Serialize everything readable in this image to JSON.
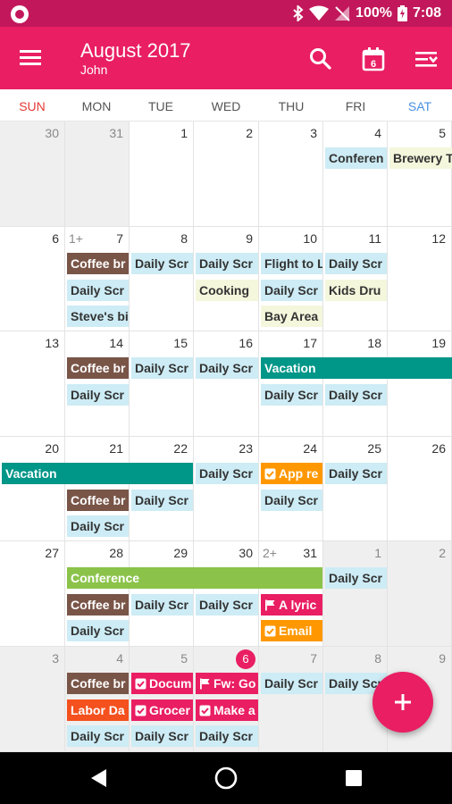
{
  "status": {
    "battery": "100%",
    "time": "7:08"
  },
  "appbar": {
    "title": "August 2017",
    "subtitle": "John",
    "today_badge": "6"
  },
  "weekdays": [
    "SUN",
    "MON",
    "TUE",
    "WED",
    "THU",
    "FRI",
    "SAT"
  ],
  "weekday_colors": {
    "sun": "#e53935",
    "sat": "#4a90e2"
  },
  "weeks": [
    {
      "days": [
        "30",
        "31",
        "1",
        "2",
        "3",
        "4",
        "5"
      ]
    },
    {
      "days": [
        "6",
        "7",
        "8",
        "9",
        "10",
        "11",
        "12"
      ],
      "more": "1+"
    },
    {
      "days": [
        "13",
        "14",
        "15",
        "16",
        "17",
        "18",
        "19"
      ]
    },
    {
      "days": [
        "20",
        "21",
        "22",
        "23",
        "24",
        "25",
        "26"
      ]
    },
    {
      "days": [
        "27",
        "28",
        "29",
        "30",
        "31",
        "1",
        "2"
      ],
      "more": "2+"
    },
    {
      "days": [
        "3",
        "4",
        "5",
        "6",
        "7",
        "8",
        "9"
      ]
    }
  ],
  "events": {
    "w1": [
      "Conferen",
      "Brewery T"
    ],
    "w2": [
      "Coffee br",
      "Daily Scr",
      "Steve's bi",
      "Daily Scr",
      "Daily Scr",
      "Cooking",
      "Flight to L",
      "Daily Scr",
      "Bay Area",
      "Daily Scr",
      "Kids Dru"
    ],
    "w3": [
      "Coffee br",
      "Daily Scr",
      "Daily Scr",
      "Daily Scr",
      "Vacation",
      "Daily Scr",
      "Daily Scr"
    ],
    "w4": [
      "Vacation",
      "Coffee br",
      "Daily Scr",
      "Daily Scr",
      "Daily Scr",
      "App re",
      "Daily Scr",
      "Daily Scr"
    ],
    "w5": [
      "Conference",
      "Coffee br",
      "Daily Scr",
      "Daily Scr",
      "Daily Scr",
      "A lyric",
      "Email",
      "Daily Scr"
    ],
    "w6": [
      "Coffee br",
      "Labor Da",
      "Daily Scr",
      "Docum",
      "Grocer",
      "Daily Scr",
      "Fw: Go",
      "Make a",
      "Daily Scr",
      "Daily Scr",
      "Daily Scr"
    ]
  },
  "icons": {
    "menu": "hamburger-menu-icon",
    "search": "search-icon",
    "today": "calendar-today-icon",
    "view": "view-options-icon",
    "add": "plus-icon"
  },
  "colors": {
    "primary": "#e91e63",
    "primary_dark": "#c2185b"
  }
}
